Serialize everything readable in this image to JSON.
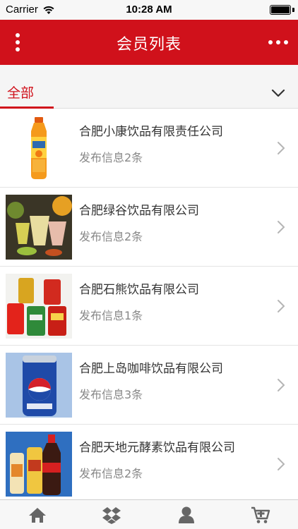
{
  "status_bar": {
    "carrier": "Carrier",
    "time": "10:28 AM"
  },
  "header": {
    "title": "会员列表"
  },
  "filter": {
    "tab_label": "全部"
  },
  "members": [
    {
      "name": "合肥小康饮品有限责任公司",
      "info": "发布信息2条",
      "image": "orange-juice-bottle"
    },
    {
      "name": "合肥绿谷饮品有限公司",
      "info": "发布信息2条",
      "image": "fresh-juice-glasses"
    },
    {
      "name": "合肥石熊饮品有限公司",
      "info": "发布信息1条",
      "image": "soda-cans"
    },
    {
      "name": "合肥上岛咖啡饮品有限公司",
      "info": "发布信息3条",
      "image": "pepsi-can"
    },
    {
      "name": "合肥天地元酵素饮品有限公司",
      "info": "发布信息2条",
      "image": "drink-bottles"
    }
  ],
  "tab_bar": [
    "home-icon",
    "dropbox-icon",
    "user-icon",
    "add-cart-icon"
  ],
  "colors": {
    "brand_red": "#d0111b",
    "text_dark": "#333333",
    "text_gray": "#888888"
  }
}
